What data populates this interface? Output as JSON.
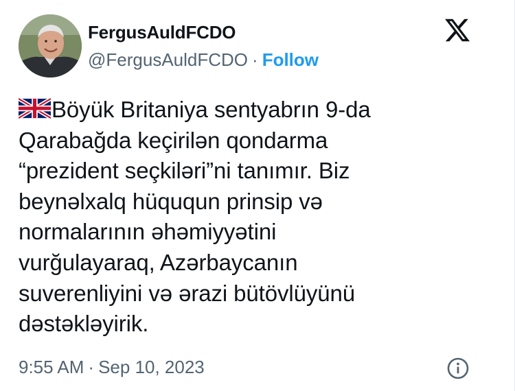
{
  "author": {
    "display_name": "FergusAuldFCDO",
    "handle": "@FergusAuldFCDO",
    "separator": "·",
    "follow_label": "Follow",
    "avatar_icon": "user-avatar-photo"
  },
  "platform": {
    "logo_icon": "x-logo-icon"
  },
  "tweet": {
    "flag_icon": "uk-flag-icon",
    "lines": [
      "Böyük Britaniya sentyabrın 9-da",
      "Qarabağda keçirilən qondarma",
      "“prezident seçkiləri”ni tanımır. Biz",
      "beynəlxalq hüququn prinsip və",
      "normalarının əhəmiyyətini",
      "vurğulayaraq, Azərbaycanın",
      "suverenliyini və ərazi bütövlüyünü",
      "dəstəkləyirik."
    ]
  },
  "meta": {
    "time": "9:55 AM",
    "separator": "·",
    "date": "Sep 10, 2023",
    "info_icon": "info-icon"
  },
  "colors": {
    "text": "#0f1419",
    "secondary": "#536471",
    "accent": "#1d9bf0"
  }
}
